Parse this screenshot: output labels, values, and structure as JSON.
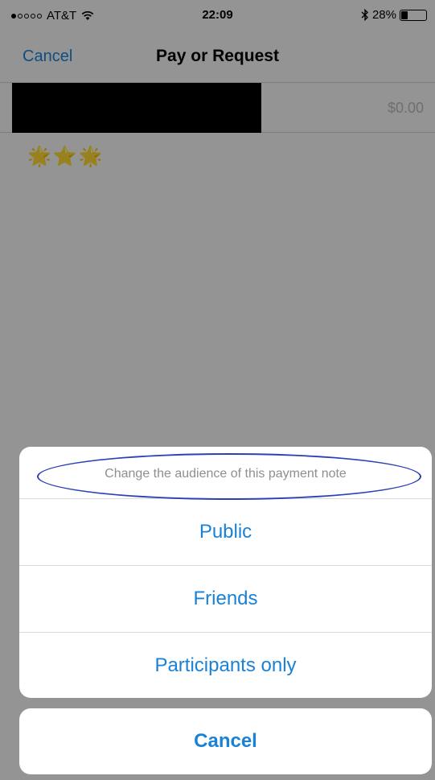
{
  "status_bar": {
    "signal_filled": 1,
    "signal_total": 5,
    "carrier": "AT&T",
    "time": "22:09",
    "battery_percent": "28%",
    "battery_level": 0.28,
    "icons": {
      "wifi": "wifi-icon",
      "bluetooth": "bluetooth-icon",
      "battery": "battery-icon"
    }
  },
  "nav": {
    "cancel_label": "Cancel",
    "title": "Pay or Request"
  },
  "payment": {
    "amount": "$0.00",
    "recipient_redacted": true
  },
  "note": {
    "emoji": [
      "🌟",
      "⭐",
      "🌟"
    ]
  },
  "action_sheet": {
    "header": "Change the audience of this payment note",
    "options": [
      "Public",
      "Friends",
      "Participants only"
    ],
    "cancel_label": "Cancel"
  },
  "colors": {
    "accent": "#1a82d6",
    "annotation": "#2b3fb8",
    "overlay": "rgba(0,0,0,0.40)"
  }
}
